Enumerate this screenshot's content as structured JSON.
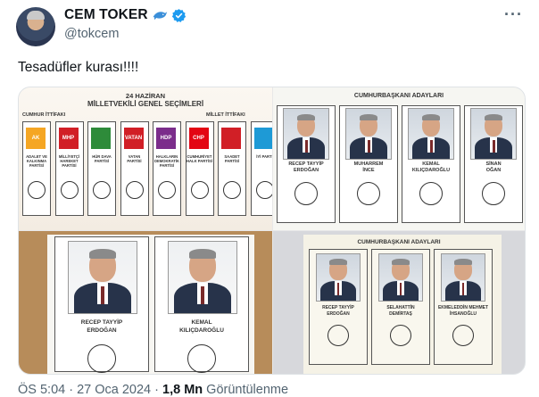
{
  "author": {
    "name": "CEM TOKER",
    "handle": "@tokcem",
    "emoji": "dolphin-icon",
    "verified_color": "#1d9bf0"
  },
  "tweet": {
    "text": "Tesadüfler kurası!!!!"
  },
  "ballot1": {
    "title_line1": "24 HAZİRAN",
    "title_line2": "MİLLETVEKİLİ GENEL SEÇİMLERİ",
    "alliance_left": "CUMHUR İTTİFAKI",
    "alliance_right": "MİLLET İTTİFAKI",
    "parties": [
      {
        "logo": "AK",
        "name": "ADALET VE KALKINMA PARTİSİ",
        "color": "#f5a623"
      },
      {
        "logo": "MHP",
        "name": "MİLLİYETÇİ HAREKET PARTİSİ",
        "color": "#d11f26"
      },
      {
        "logo": "",
        "name": "HÜR DAVA PARTİSİ",
        "color": "#2e8b3a"
      },
      {
        "logo": "VATAN",
        "name": "VATAN PARTİSİ",
        "color": "#d11f26"
      },
      {
        "logo": "HDP",
        "name": "HALKLARIN DEMOKRATİK PARTİSİ",
        "color": "#7b2d8b"
      },
      {
        "logo": "CHP",
        "name": "CUMHURİYET HALK PARTİSİ",
        "color": "#e30613"
      },
      {
        "logo": "",
        "name": "SAADET PARTİSİ",
        "color": "#d11f26"
      },
      {
        "logo": "",
        "name": "İYİ PARTİ",
        "color": "#1e9ad6"
      }
    ]
  },
  "ballot2": {
    "title": "CUMHURBAŞKANI ADAYLARI",
    "candidates": [
      {
        "name1": "RECEP TAYYİP",
        "name2": "ERDOĞAN"
      },
      {
        "name1": "MUHARREM",
        "name2": "İNCE"
      },
      {
        "name1": "KEMAL",
        "name2": "KILIÇDAROĞLU"
      },
      {
        "name1": "SİNAN",
        "name2": "OĞAN"
      }
    ]
  },
  "ballot3": {
    "candidates": [
      {
        "name1": "RECEP TAYYİP",
        "name2": "ERDOĞAN"
      },
      {
        "name1": "KEMAL",
        "name2": "KILIÇDAROĞLU"
      }
    ]
  },
  "ballot4": {
    "title": "CUMHURBAŞKANI ADAYLARI",
    "candidates": [
      {
        "name1": "RECEP TAYYİP",
        "name2": "ERDOĞAN"
      },
      {
        "name1": "SELAHATTİN",
        "name2": "DEMİRTAŞ"
      },
      {
        "name1": "EKMELEDDİN MEHMET",
        "name2": "İHSANOĞLU"
      }
    ]
  },
  "footer": {
    "time": "ÖS 5:04 · 27 Oca 2024 · ",
    "views_count": "1,8 Mn",
    "views_label": " Görüntülenme"
  }
}
